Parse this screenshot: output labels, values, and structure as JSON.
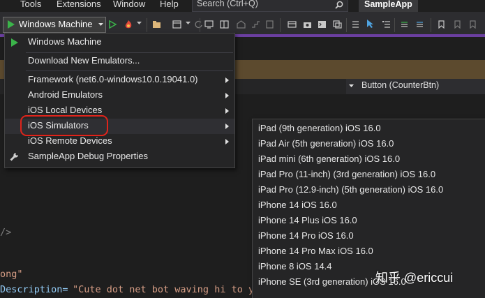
{
  "menubar": {
    "items": [
      "Tools",
      "Extensions",
      "Window",
      "Help"
    ],
    "search_placeholder": "Search (Ctrl+Q)",
    "app_name": "SampleApp"
  },
  "toolbar": {
    "run_target": "Windows Machine"
  },
  "nav": {
    "member": "Button (CounterBtn)"
  },
  "main_menu": {
    "items": [
      {
        "label": "Windows Machine",
        "icon": "play-icon",
        "submenu": false
      },
      {
        "label": "Download New Emulators...",
        "icon": "",
        "submenu": false
      },
      {
        "label": "Framework (net6.0-windows10.0.19041.0)",
        "icon": "",
        "submenu": true
      },
      {
        "label": "Android Emulators",
        "icon": "",
        "submenu": true
      },
      {
        "label": "iOS Local Devices",
        "icon": "",
        "submenu": true
      },
      {
        "label": "iOS Simulators",
        "icon": "",
        "submenu": true
      },
      {
        "label": "iOS Remote Devices",
        "icon": "",
        "submenu": true
      },
      {
        "label": "SampleApp Debug Properties",
        "icon": "wrench-icon",
        "submenu": false
      }
    ]
  },
  "sub_menu": {
    "items": [
      "iPad (9th generation) iOS 16.0",
      "iPad Air (5th generation) iOS 16.0",
      "iPad mini (6th generation) iOS 16.0",
      "iPad Pro (11-inch) (3rd generation) iOS 16.0",
      "iPad Pro (12.9-inch) (5th generation) iOS 16.0",
      "iPhone 14 iOS 16.0",
      "iPhone 14 Plus iOS 16.0",
      "iPhone 14 Pro iOS 16.0",
      "iPhone 14 Pro Max iOS 16.0",
      "iPhone 8 iOS 14.4",
      "iPhone SE (3rd generation) iOS 16.0"
    ]
  },
  "code": {
    "line1": "/>",
    "line2": "ong\"",
    "line3_attr": "Description=",
    "line3_value": "\"Cute dot net bot waving hi to you!\""
  },
  "watermark": "知乎 @ericcui",
  "colors": {
    "accent": "#6b3fa0",
    "play": "#3bb44a",
    "highlight_circle": "#e0241b"
  }
}
